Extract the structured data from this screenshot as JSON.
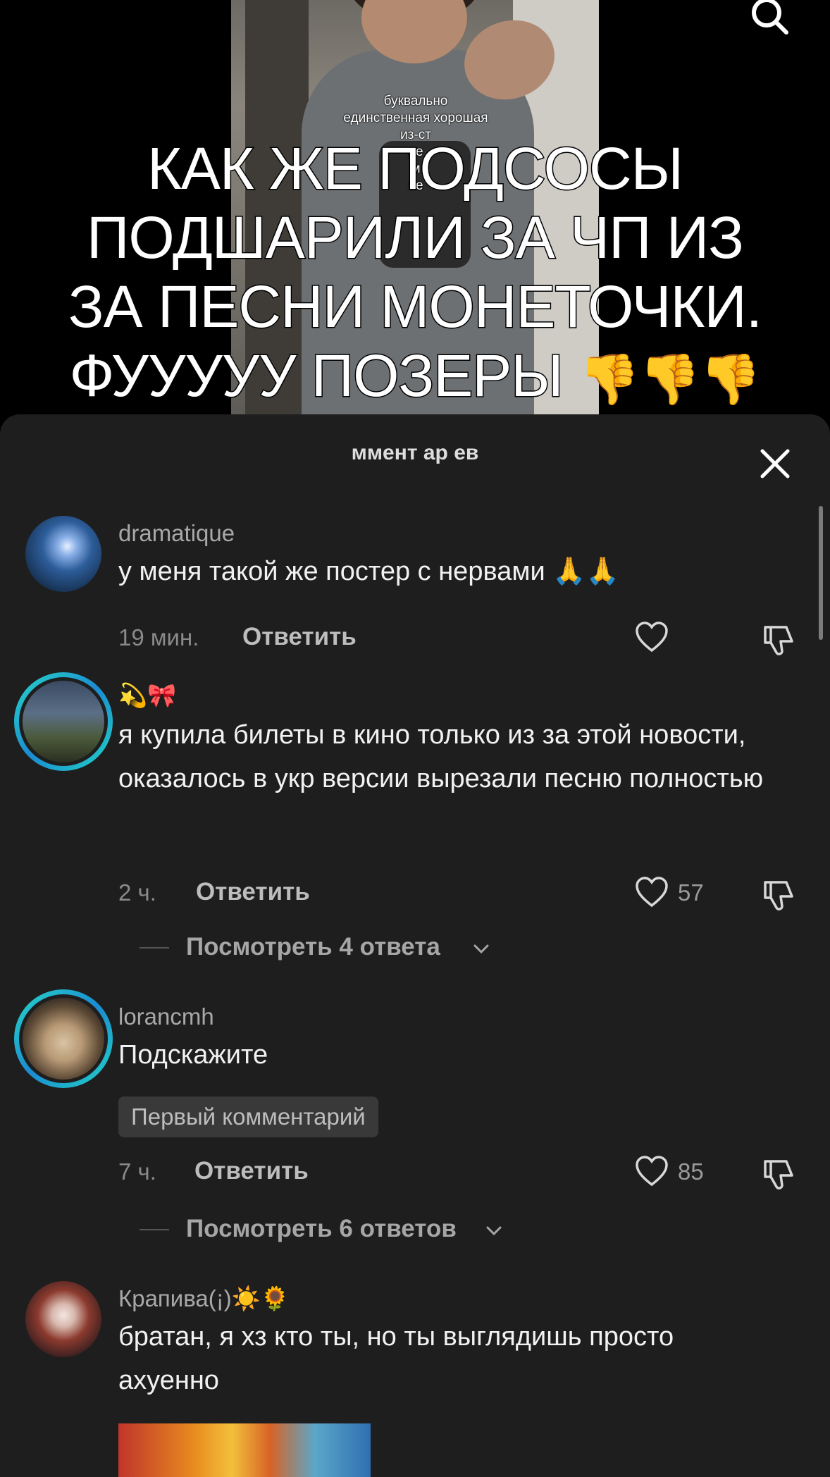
{
  "video": {
    "caption_lines": [
      "буквально",
      "единственная хорошая",
      "из-ст",
      "ре",
      "м",
      "не"
    ],
    "overlay_text": "КАК ЖЕ ПОДСОСЫ ПОДШАРИЛИ ЗА ЧП ИЗ ЗА ПЕСНИ МОНЕТОЧКИ. ФУУУУУ ПОЗЕРЫ",
    "overlay_emoji": "👎👎👎"
  },
  "sheet": {
    "comment_count_label": "ммент    ар ев"
  },
  "comments": [
    {
      "username": "dramatique",
      "text": "у меня такой же постер с нервами",
      "text_emoji": "🙏🙏",
      "time": "19 мин.",
      "reply_label": "Ответить",
      "likes": ""
    },
    {
      "username": "💫🎀",
      "text": "я купила билеты в кино только из за этой новости, оказалось в укр версии вырезали песню полностью",
      "time": "2 ч.",
      "reply_label": "Ответить",
      "likes": "57",
      "view_replies": "Посмотреть 4 ответа"
    },
    {
      "username": "lorancmh",
      "text": "Подскажите",
      "badge": "Первый комментарий",
      "time": "7 ч.",
      "reply_label": "Ответить",
      "likes": "85",
      "view_replies": "Посмотреть 6 ответов"
    },
    {
      "username": "Крапива(¡)☀️🌻",
      "text": "братан, я хз кто ты, но ты выглядишь просто ахуенно"
    }
  ],
  "colors": {
    "sheet_bg": "#1e1e1e",
    "story_ring": "#22d3c5"
  },
  "icons": [
    "search-icon",
    "close-icon",
    "heart-icon",
    "dislike-icon",
    "chevron-down-icon"
  ]
}
